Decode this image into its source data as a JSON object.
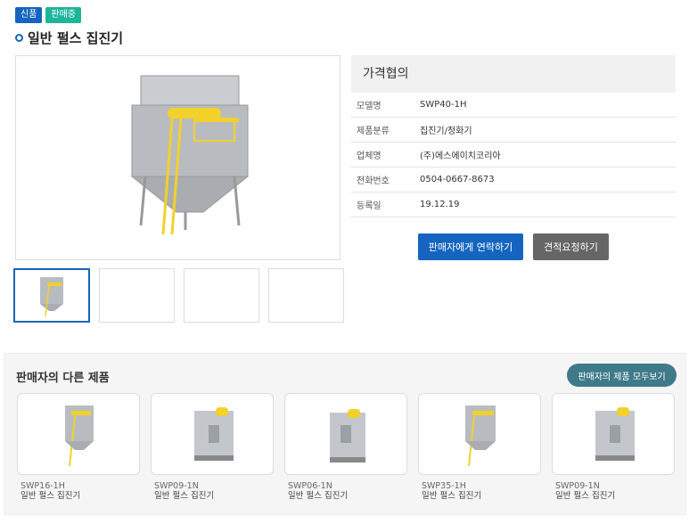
{
  "badges": {
    "new": "신품",
    "sale": "판매중"
  },
  "product": {
    "title": "일반 펄스 집진기"
  },
  "info": {
    "price": "가격협의",
    "rows": [
      {
        "k": "모델명",
        "v": "SWP40-1H"
      },
      {
        "k": "제품분류",
        "v": "집진기/정화기"
      },
      {
        "k": "업체명",
        "v": "(주)에스에이치코리아"
      },
      {
        "k": "전화번호",
        "v": "0504-0667-8673"
      },
      {
        "k": "등록일",
        "v": "19.12.19"
      }
    ]
  },
  "buttons": {
    "contact": "판매자에게 연락하기",
    "quote": "견적요청하기"
  },
  "others": {
    "title": "판매자의 다른 제품",
    "view_all": "판매자의 제품 모두보기",
    "items": [
      {
        "model": "SWP16-1H",
        "name": "일반 펄스 집진기"
      },
      {
        "model": "SWP09-1N",
        "name": "일반 펄스 집진기"
      },
      {
        "model": "SWP06-1N",
        "name": "일반 펄스 집진기"
      },
      {
        "model": "SWP35-1H",
        "name": "일반 펄스 집진기"
      },
      {
        "model": "SWP09-1N",
        "name": "일반 펄스 집진기"
      }
    ]
  }
}
